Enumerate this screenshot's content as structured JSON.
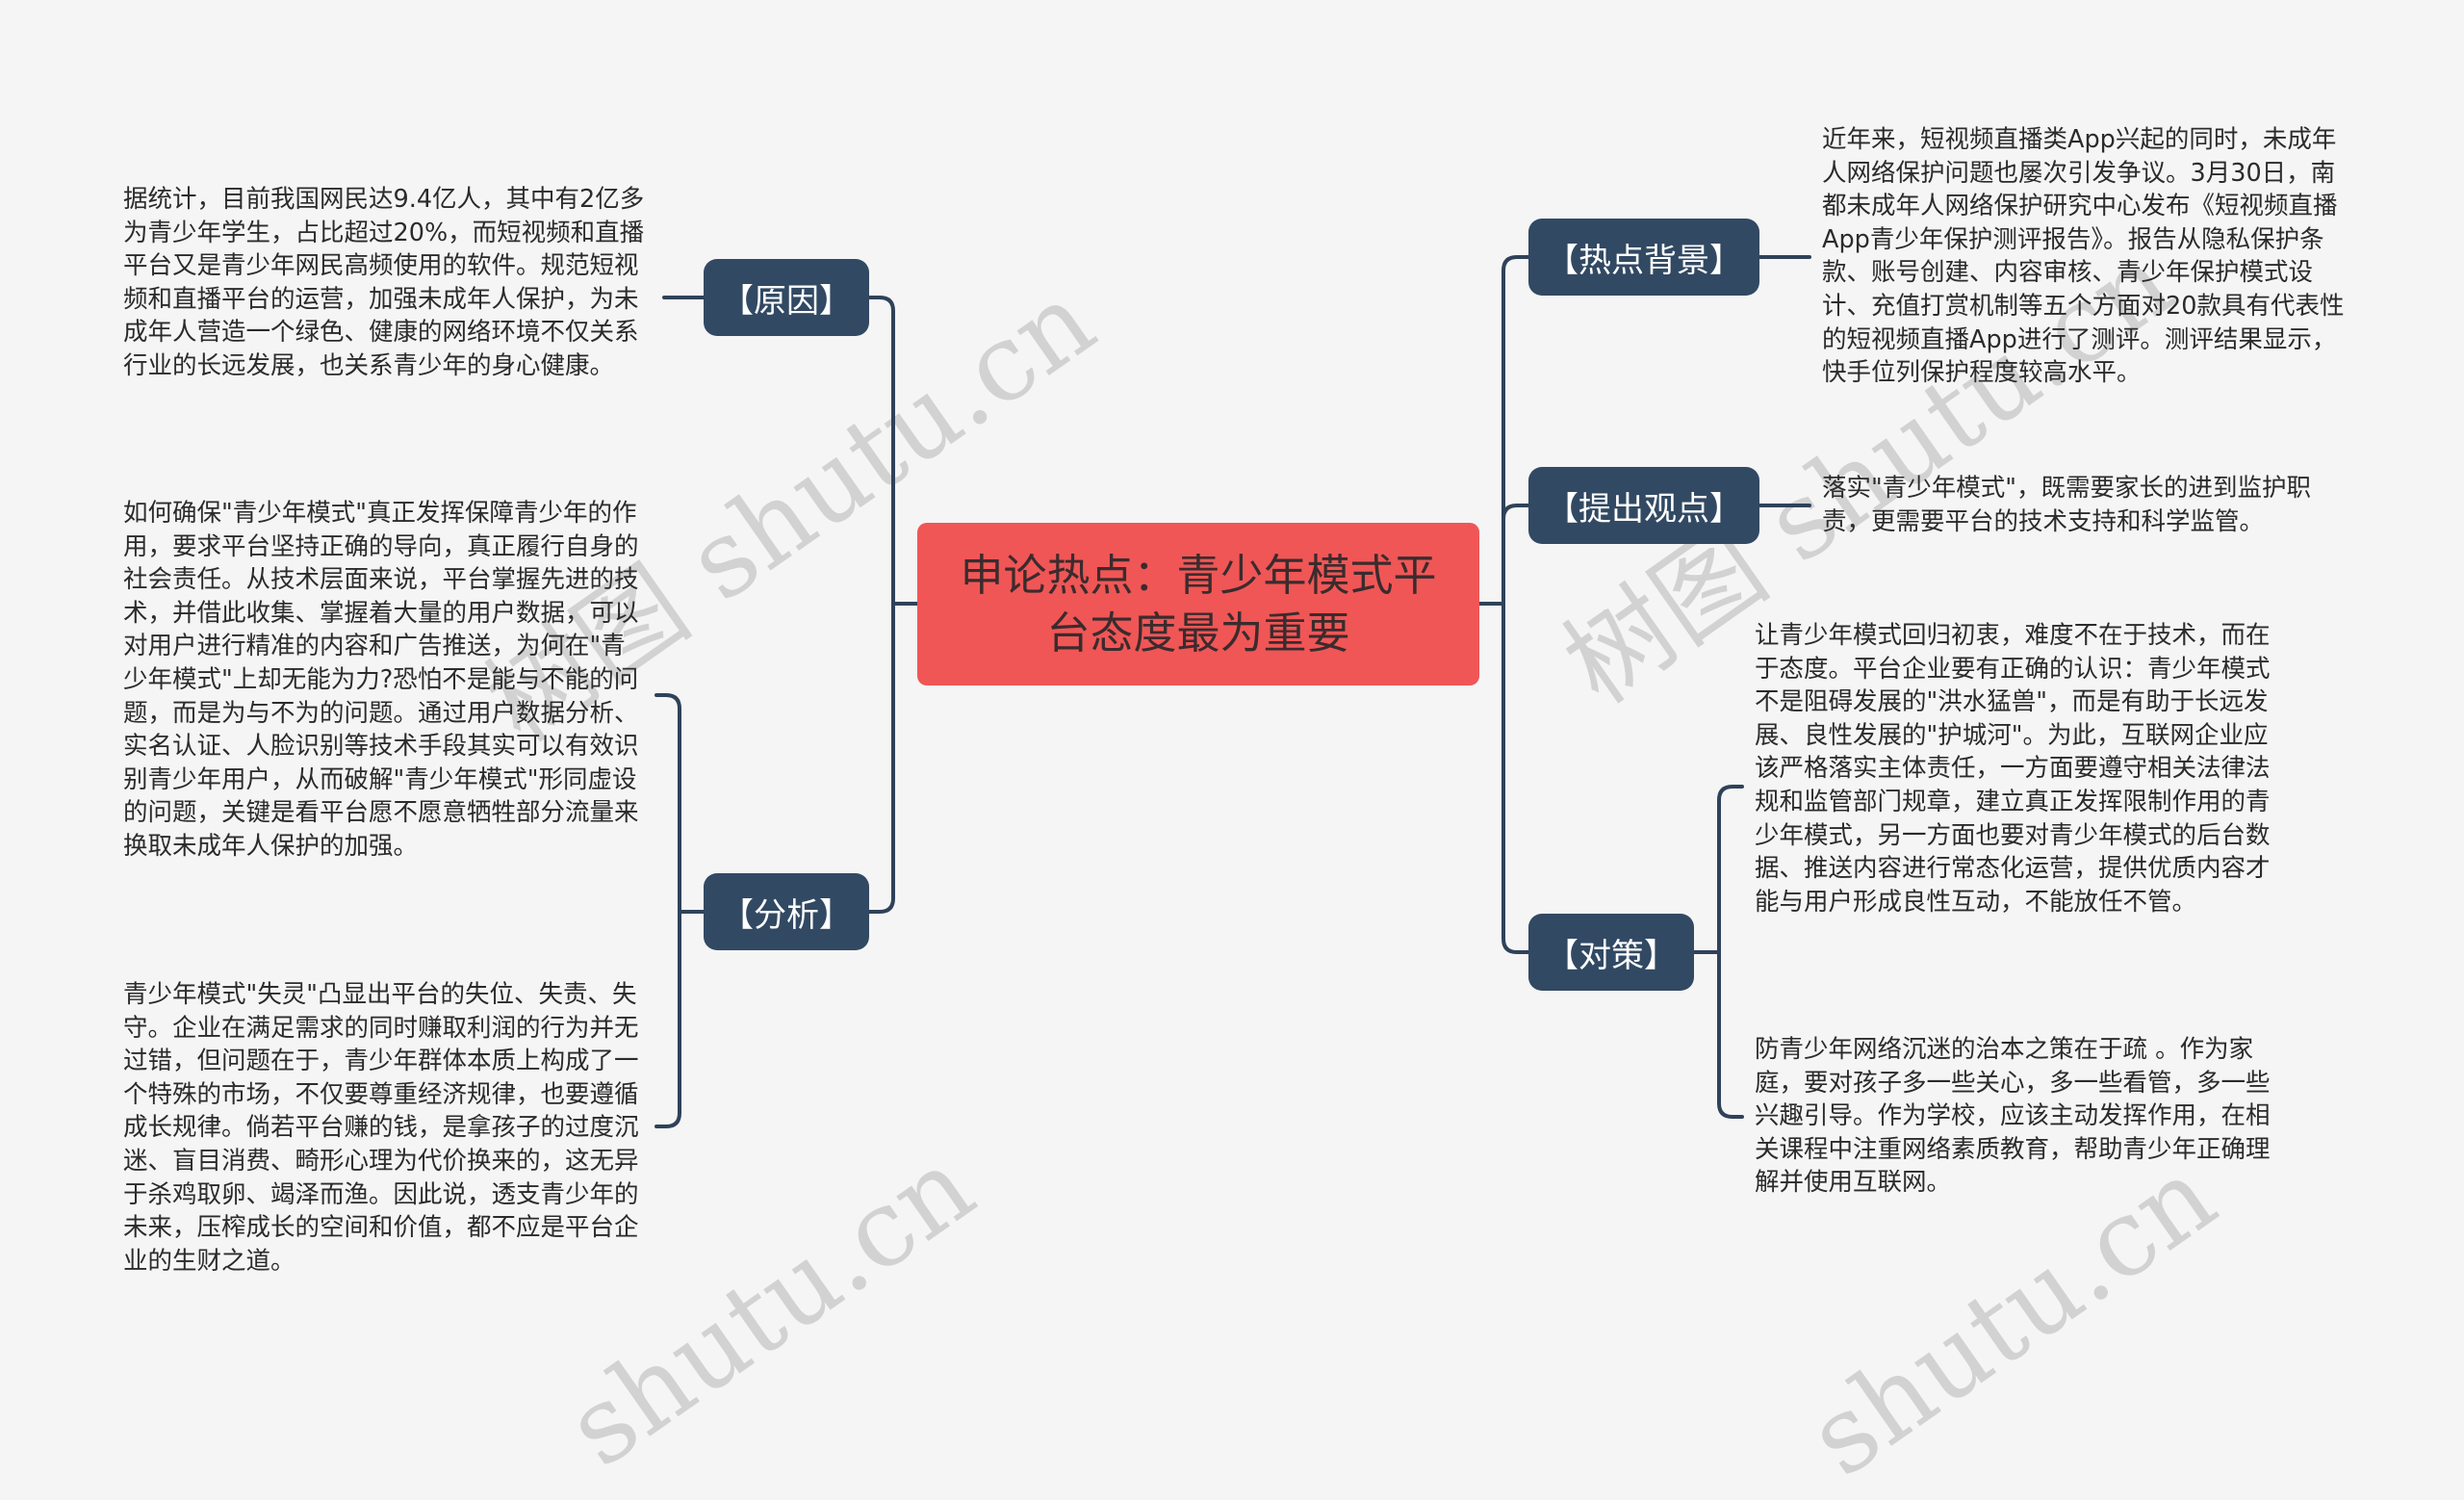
{
  "center": {
    "title": "申论热点：青少年模式平台态度最为重要"
  },
  "colors": {
    "background": "#f5f5f5",
    "center_fill": "#f05656",
    "branch_fill": "#324963",
    "line": "#2f4259",
    "text": "#2b2b2b"
  },
  "left_branches": [
    {
      "label": "【原因】",
      "children": [
        "据统计，目前我国网民达9.4亿人，其中有2亿多为青少年学生，占比超过20%，而短视频和直播平台又是青少年网民高频使用的软件。规范短视频和直播平台的运营，加强未成年人保护，为未成年人营造一个绿色、健康的网络环境不仅关系行业的长远发展，也关系青少年的身心健康。"
      ]
    },
    {
      "label": "【分析】",
      "children": [
        "如何确保\"青少年模式\"真正发挥保障青少年的作用，要求平台坚持正确的导向，真正履行自身的社会责任。从技术层面来说，平台掌握先进的技术，并借此收集、掌握着大量的用户数据，可以对用户进行精准的内容和广告推送，为何在\"青少年模式\"上却无能为力?恐怕不是能与不能的问题，而是为与不为的问题。通过用户数据分析、实名认证、人脸识别等技术手段其实可以有效识别青少年用户，从而破解\"青少年模式\"形同虚设的问题，关键是看平台愿不愿意牺牲部分流量来换取未成年人保护的加强。",
        "青少年模式\"失灵\"凸显出平台的失位、失责、失守。企业在满足需求的同时赚取利润的行为并无过错，但问题在于，青少年群体本质上构成了一个特殊的市场，不仅要尊重经济规律，也要遵循成长规律。倘若平台赚的钱，是拿孩子的过度沉迷、盲目消费、畸形心理为代价换来的，这无异于杀鸡取卵、竭泽而渔。因此说，透支青少年的未来，压榨成长的空间和价值，都不应是平台企业的生财之道。"
      ]
    }
  ],
  "right_branches": [
    {
      "label": "【热点背景】",
      "children": [
        "近年来，短视频直播类App兴起的同时，未成年人网络保护问题也屡次引发争议。3月30日，南都未成年人网络保护研究中心发布《短视频直播App青少年保护测评报告》。报告从隐私保护条款、账号创建、内容审核、青少年保护模式设计、充值打赏机制等五个方面对20款具有代表性的短视频直播App进行了测评。测评结果显示，快手位列保护程度较高水平。"
      ]
    },
    {
      "label": "【提出观点】",
      "children": [
        "落实\"青少年模式\"，既需要家长的进到监护职责，更需要平台的技术支持和科学监管。"
      ]
    },
    {
      "label": "【对策】",
      "children": [
        "让青少年模式回归初衷，难度不在于技术，而在于态度。平台企业要有正确的认识：青少年模式不是阻碍发展的\"洪水猛兽\"，而是有助于长远发展、良性发展的\"护城河\"。为此，互联网企业应该严格落实主体责任，一方面要遵守相关法律法规和监管部门规章，建立真正发挥限制作用的青少年模式，另一方面也要对青少年模式的后台数据、推送内容进行常态化运营，提供优质内容才能与用户形成良性互动，不能放任不管。",
        "防青少年网络沉迷的治本之策在于疏 。作为家庭，要对孩子多一些关心，多一些看管，多一些兴趣引导。作为学校，应该主动发挥作用，在相关课程中注重网络素质教育，帮助青少年正确理解并使用互联网。"
      ]
    }
  ],
  "watermark": {
    "text": "树图 shutu.cn",
    "partial": "shutu.cn"
  }
}
